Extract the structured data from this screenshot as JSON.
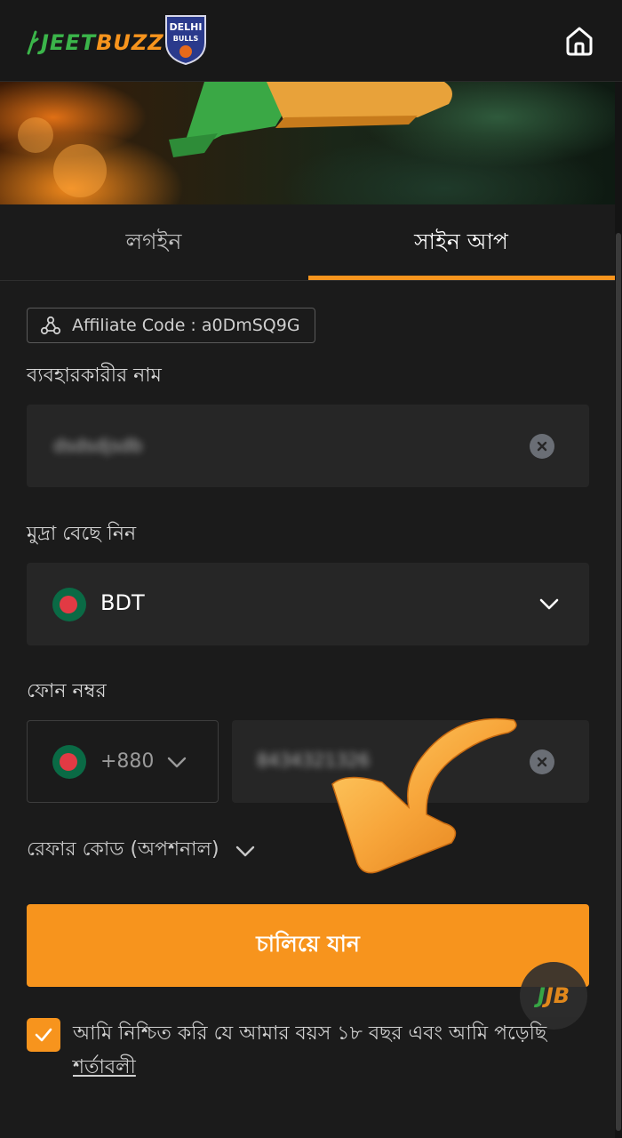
{
  "header": {
    "logo_part1": "JEET",
    "logo_part2": "BUZZ",
    "badge_text_top": "DELHI",
    "badge_text_bottom": "BULLS",
    "home_icon": "home-icon"
  },
  "tabs": [
    {
      "label": "লগইন",
      "active": false
    },
    {
      "label": "সাইন আপ",
      "active": true
    }
  ],
  "affiliate": {
    "text": "Affiliate Code : a0DmSQ9G",
    "icon": "affiliate-network-icon"
  },
  "username": {
    "label": "ব্যবহারকারীর নাম",
    "value": "dsdsdjsdb"
  },
  "currency": {
    "label": "মুদ্রা বেছে নিন",
    "selected": "BDT"
  },
  "phone": {
    "label": "ফোন নম্বর",
    "country_code": "+880",
    "value": "8434321326"
  },
  "referral": {
    "label": "রেফার কোড (অপশনাল)"
  },
  "submit": {
    "label": "চালিয়ে যান"
  },
  "chat_fab": {
    "label": "JB"
  },
  "terms": {
    "text": "আমি নিশ্চিত করি যে আমার বয়স ১৮ বছর এবং আমি পড়েছি",
    "link": "শর্তাবলী",
    "checked": true
  },
  "colors": {
    "accent": "#f7941d",
    "brand_green": "#3bb54a",
    "background": "#1b1b1b",
    "field": "#262626"
  }
}
